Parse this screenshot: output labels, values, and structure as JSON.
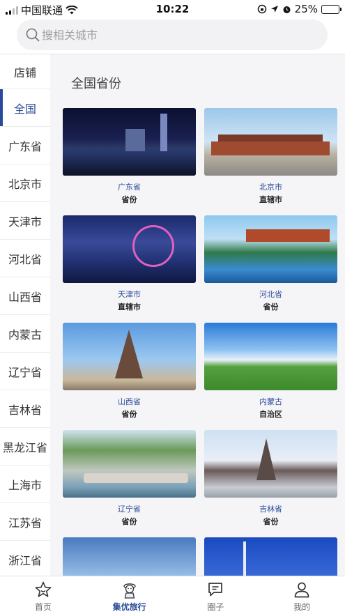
{
  "status_bar": {
    "carrier": "中国联通",
    "time": "10:22",
    "battery": "25%",
    "battery_level": 0.25
  },
  "search": {
    "placeholder": "搜相关城市"
  },
  "sidebar": {
    "items": [
      {
        "label": "店铺",
        "active": false
      },
      {
        "label": "全国",
        "active": true
      },
      {
        "label": "广东省",
        "active": false
      },
      {
        "label": "北京市",
        "active": false
      },
      {
        "label": "天津市",
        "active": false
      },
      {
        "label": "河北省",
        "active": false
      },
      {
        "label": "山西省",
        "active": false
      },
      {
        "label": "内蒙古",
        "active": false
      },
      {
        "label": "辽宁省",
        "active": false
      },
      {
        "label": "吉林省",
        "active": false
      },
      {
        "label": "黑龙江省",
        "active": false
      },
      {
        "label": "上海市",
        "active": false
      },
      {
        "label": "江苏省",
        "active": false
      },
      {
        "label": "浙江省",
        "active": false
      }
    ]
  },
  "main": {
    "section_title": "全国省份",
    "cards": [
      {
        "name": "广东省",
        "type": "省份",
        "photo": "p-gd"
      },
      {
        "name": "北京市",
        "type": "直辖市",
        "photo": "p-bj"
      },
      {
        "name": "天津市",
        "type": "直辖市",
        "photo": "p-tj"
      },
      {
        "name": "河北省",
        "type": "省份",
        "photo": "p-hb"
      },
      {
        "name": "山西省",
        "type": "省份",
        "photo": "p-sx"
      },
      {
        "name": "内蒙古",
        "type": "自治区",
        "photo": "p-nm"
      },
      {
        "name": "辽宁省",
        "type": "省份",
        "photo": "p-ln"
      },
      {
        "name": "吉林省",
        "type": "省份",
        "photo": "p-jl"
      },
      {
        "name": "",
        "type": "",
        "photo": "p-sh"
      },
      {
        "name": "",
        "type": "",
        "photo": "p-js"
      }
    ]
  },
  "tabbar": {
    "tabs": [
      {
        "label": "首页",
        "icon": "star-icon",
        "active": false
      },
      {
        "label": "集优旅行",
        "icon": "mascot-icon",
        "active": true
      },
      {
        "label": "圈子",
        "icon": "chat-icon",
        "active": false
      },
      {
        "label": "我的",
        "icon": "user-icon",
        "active": false
      }
    ],
    "accent": "#2b4a9a"
  }
}
